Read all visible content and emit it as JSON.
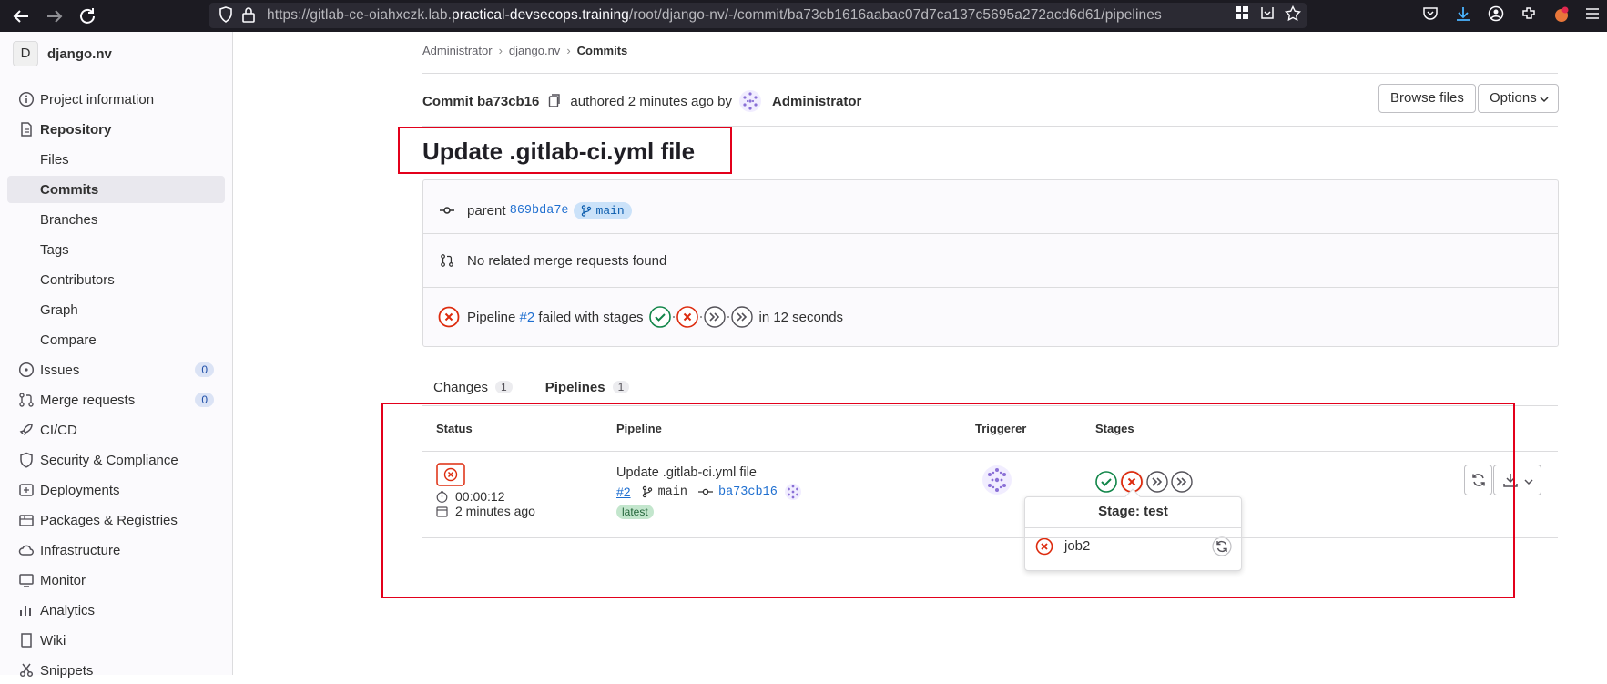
{
  "browser": {
    "url_prefix": "https://gitlab-ce-oiahxczk.lab.",
    "url_domain": "practical-devsecops.training",
    "url_path": "/root/django-nv/-/commit/ba73cb1616aabac07d7ca137c5695a272acd6d61/pipelines"
  },
  "sidebar": {
    "project_avatar": "D",
    "project_name": "django.nv",
    "items": [
      {
        "label": "Project information",
        "icon": "info-icon"
      },
      {
        "label": "Repository",
        "icon": "document-icon"
      },
      {
        "label": "Files"
      },
      {
        "label": "Commits"
      },
      {
        "label": "Branches"
      },
      {
        "label": "Tags"
      },
      {
        "label": "Contributors"
      },
      {
        "label": "Graph"
      },
      {
        "label": "Compare"
      },
      {
        "label": "Issues",
        "icon": "issues-icon",
        "count": "0"
      },
      {
        "label": "Merge requests",
        "icon": "merge-request-icon",
        "count": "0"
      },
      {
        "label": "CI/CD",
        "icon": "rocket-icon"
      },
      {
        "label": "Security & Compliance",
        "icon": "shield-icon"
      },
      {
        "label": "Deployments",
        "icon": "deployments-icon"
      },
      {
        "label": "Packages & Registries",
        "icon": "package-icon"
      },
      {
        "label": "Infrastructure",
        "icon": "cloud-icon"
      },
      {
        "label": "Monitor",
        "icon": "monitor-icon"
      },
      {
        "label": "Analytics",
        "icon": "chart-icon"
      },
      {
        "label": "Wiki",
        "icon": "book-icon"
      },
      {
        "label": "Snippets",
        "icon": "snippet-icon"
      }
    ]
  },
  "breadcrumb": {
    "root": "Administrator",
    "project": "django.nv",
    "current": "Commits"
  },
  "commit": {
    "label": "Commit",
    "sha_short": "ba73cb16",
    "authored": "authored 2 minutes ago by",
    "author": "Administrator",
    "title": "Update .gitlab-ci.yml file",
    "browse_files": "Browse files",
    "options": "Options"
  },
  "info": {
    "parent_label": "parent",
    "parent_sha": "869bda7e",
    "branch": "main",
    "mr_text": "No related merge requests found",
    "pipeline_label": "Pipeline",
    "pipeline_id": "#2",
    "failed_text": "failed with stages",
    "duration_text": "in 12 seconds"
  },
  "tabs": [
    {
      "label": "Changes",
      "count": "1"
    },
    {
      "label": "Pipelines",
      "count": "1"
    }
  ],
  "table": {
    "headers": [
      "Status",
      "Pipeline",
      "Triggerer",
      "Stages"
    ],
    "row": {
      "duration": "00:00:12",
      "finished": "2 minutes ago",
      "title": "Update .gitlab-ci.yml file",
      "id": "#2",
      "branch": "main",
      "sha": "ba73cb16",
      "tag": "latest"
    }
  },
  "popover": {
    "title": "Stage: test",
    "job": "job2"
  },
  "colors": {
    "success": "#108548",
    "failed": "#dd2b0e",
    "link": "#1f6fd0",
    "highlight": "#e3001b"
  }
}
